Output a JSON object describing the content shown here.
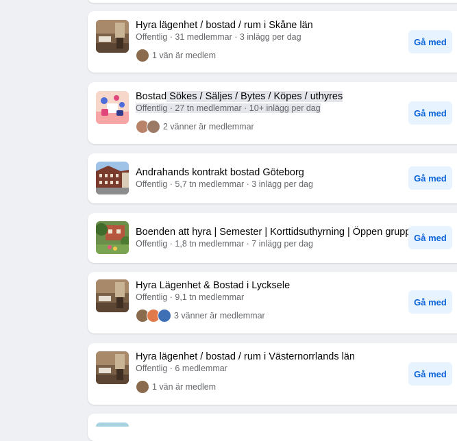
{
  "groups": [
    {
      "name": "Hyra lägenhet / bostad / rum i Skåne län",
      "meta": "Offentlig · 31 medlemmar · 3 inlägg per dag",
      "friends": "1 vän är medlem",
      "button": "Gå med",
      "thumb": "room-photo-icon"
    },
    {
      "name_a": "Bostad",
      "name_b": " Sökes / Säljes / Bytes / Köpes / uthyres",
      "meta_a": "Offentlig · 27 tn medlemmar · 10+ inlägg per dag",
      "friends": "2 vänner är medlemmar",
      "button": "Gå med",
      "thumb": "illustration-icon"
    },
    {
      "name": "Andrahands kontrakt bostad Göteborg",
      "meta": "Offentlig · 5,7 tn medlemmar · 3 inlägg per dag",
      "button": "Gå med",
      "thumb": "building-photo-icon"
    },
    {
      "name": "Boenden att hyra | Semester | Korttidsuthyrning | Öppen grupp",
      "meta": "Offentlig · 1,8 tn medlemmar · 7 inlägg per dag",
      "button": "Gå med",
      "thumb": "house-garden-photo-icon"
    },
    {
      "name": "Hyra Lägenhet & Bostad i Lycksele",
      "meta": "Offentlig · 9,1 tn medlemmar",
      "friends": "3 vänner är medlemmar",
      "button": "Gå med",
      "thumb": "room-photo-icon"
    },
    {
      "name": "Hyra lägenhet / bostad / rum i Västernorrlands län",
      "meta": "Offentlig · 6 medlemmar",
      "friends": "1 vän är medlem",
      "button": "Gå med",
      "thumb": "room-photo-icon"
    }
  ],
  "colors": {
    "page_bg": "#eef0f3",
    "card_bg": "#ffffff",
    "button_bg": "#e7f3ff",
    "button_text": "#0d65d9",
    "meta_text": "#65676b"
  }
}
